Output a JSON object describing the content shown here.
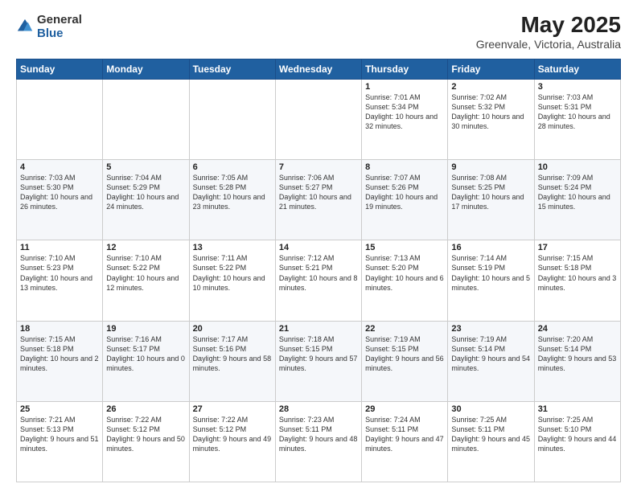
{
  "logo": {
    "text_general": "General",
    "text_blue": "Blue"
  },
  "title": "May 2025",
  "subtitle": "Greenvale, Victoria, Australia",
  "days_of_week": [
    "Sunday",
    "Monday",
    "Tuesday",
    "Wednesday",
    "Thursday",
    "Friday",
    "Saturday"
  ],
  "weeks": [
    [
      {
        "day": "",
        "content": ""
      },
      {
        "day": "",
        "content": ""
      },
      {
        "day": "",
        "content": ""
      },
      {
        "day": "",
        "content": ""
      },
      {
        "day": "1",
        "content": "Sunrise: 7:01 AM\nSunset: 5:34 PM\nDaylight: 10 hours\nand 32 minutes."
      },
      {
        "day": "2",
        "content": "Sunrise: 7:02 AM\nSunset: 5:32 PM\nDaylight: 10 hours\nand 30 minutes."
      },
      {
        "day": "3",
        "content": "Sunrise: 7:03 AM\nSunset: 5:31 PM\nDaylight: 10 hours\nand 28 minutes."
      }
    ],
    [
      {
        "day": "4",
        "content": "Sunrise: 7:03 AM\nSunset: 5:30 PM\nDaylight: 10 hours\nand 26 minutes."
      },
      {
        "day": "5",
        "content": "Sunrise: 7:04 AM\nSunset: 5:29 PM\nDaylight: 10 hours\nand 24 minutes."
      },
      {
        "day": "6",
        "content": "Sunrise: 7:05 AM\nSunset: 5:28 PM\nDaylight: 10 hours\nand 23 minutes."
      },
      {
        "day": "7",
        "content": "Sunrise: 7:06 AM\nSunset: 5:27 PM\nDaylight: 10 hours\nand 21 minutes."
      },
      {
        "day": "8",
        "content": "Sunrise: 7:07 AM\nSunset: 5:26 PM\nDaylight: 10 hours\nand 19 minutes."
      },
      {
        "day": "9",
        "content": "Sunrise: 7:08 AM\nSunset: 5:25 PM\nDaylight: 10 hours\nand 17 minutes."
      },
      {
        "day": "10",
        "content": "Sunrise: 7:09 AM\nSunset: 5:24 PM\nDaylight: 10 hours\nand 15 minutes."
      }
    ],
    [
      {
        "day": "11",
        "content": "Sunrise: 7:10 AM\nSunset: 5:23 PM\nDaylight: 10 hours\nand 13 minutes."
      },
      {
        "day": "12",
        "content": "Sunrise: 7:10 AM\nSunset: 5:22 PM\nDaylight: 10 hours\nand 12 minutes."
      },
      {
        "day": "13",
        "content": "Sunrise: 7:11 AM\nSunset: 5:22 PM\nDaylight: 10 hours\nand 10 minutes."
      },
      {
        "day": "14",
        "content": "Sunrise: 7:12 AM\nSunset: 5:21 PM\nDaylight: 10 hours\nand 8 minutes."
      },
      {
        "day": "15",
        "content": "Sunrise: 7:13 AM\nSunset: 5:20 PM\nDaylight: 10 hours\nand 6 minutes."
      },
      {
        "day": "16",
        "content": "Sunrise: 7:14 AM\nSunset: 5:19 PM\nDaylight: 10 hours\nand 5 minutes."
      },
      {
        "day": "17",
        "content": "Sunrise: 7:15 AM\nSunset: 5:18 PM\nDaylight: 10 hours\nand 3 minutes."
      }
    ],
    [
      {
        "day": "18",
        "content": "Sunrise: 7:15 AM\nSunset: 5:18 PM\nDaylight: 10 hours\nand 2 minutes."
      },
      {
        "day": "19",
        "content": "Sunrise: 7:16 AM\nSunset: 5:17 PM\nDaylight: 10 hours\nand 0 minutes."
      },
      {
        "day": "20",
        "content": "Sunrise: 7:17 AM\nSunset: 5:16 PM\nDaylight: 9 hours\nand 58 minutes."
      },
      {
        "day": "21",
        "content": "Sunrise: 7:18 AM\nSunset: 5:15 PM\nDaylight: 9 hours\nand 57 minutes."
      },
      {
        "day": "22",
        "content": "Sunrise: 7:19 AM\nSunset: 5:15 PM\nDaylight: 9 hours\nand 56 minutes."
      },
      {
        "day": "23",
        "content": "Sunrise: 7:19 AM\nSunset: 5:14 PM\nDaylight: 9 hours\nand 54 minutes."
      },
      {
        "day": "24",
        "content": "Sunrise: 7:20 AM\nSunset: 5:14 PM\nDaylight: 9 hours\nand 53 minutes."
      }
    ],
    [
      {
        "day": "25",
        "content": "Sunrise: 7:21 AM\nSunset: 5:13 PM\nDaylight: 9 hours\nand 51 minutes."
      },
      {
        "day": "26",
        "content": "Sunrise: 7:22 AM\nSunset: 5:12 PM\nDaylight: 9 hours\nand 50 minutes."
      },
      {
        "day": "27",
        "content": "Sunrise: 7:22 AM\nSunset: 5:12 PM\nDaylight: 9 hours\nand 49 minutes."
      },
      {
        "day": "28",
        "content": "Sunrise: 7:23 AM\nSunset: 5:11 PM\nDaylight: 9 hours\nand 48 minutes."
      },
      {
        "day": "29",
        "content": "Sunrise: 7:24 AM\nSunset: 5:11 PM\nDaylight: 9 hours\nand 47 minutes."
      },
      {
        "day": "30",
        "content": "Sunrise: 7:25 AM\nSunset: 5:11 PM\nDaylight: 9 hours\nand 45 minutes."
      },
      {
        "day": "31",
        "content": "Sunrise: 7:25 AM\nSunset: 5:10 PM\nDaylight: 9 hours\nand 44 minutes."
      }
    ]
  ]
}
